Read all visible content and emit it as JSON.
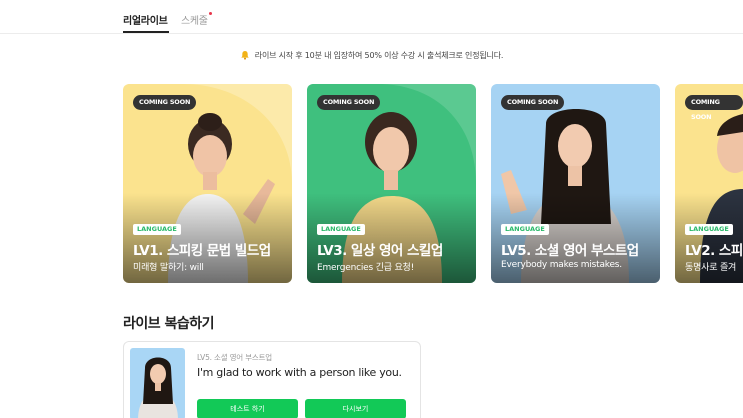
{
  "tabs": {
    "live": "리얼라이브",
    "schedule": "스케줄"
  },
  "notice": {
    "text": "라이브 시작 후 10분 내 입장하여 50% 이상 수강 시 출석체크로 인정됩니다."
  },
  "cards": [
    {
      "status": "COMING SOON",
      "category": "LANGUAGE",
      "title": "LV1. 스피킹 문법 빌드업",
      "subtitle": "미래형 말하기: will",
      "bg_color": "#fbe38e"
    },
    {
      "status": "COMING SOON",
      "category": "LANGUAGE",
      "title": "LV3. 일상 영어 스킬업",
      "subtitle": "Emergencies 긴급 요청!",
      "bg_color": "#3fc07e"
    },
    {
      "status": "COMING SOON",
      "category": "LANGUAGE",
      "title": "LV5. 소셜 영어 부스트업",
      "subtitle": "Everybody makes mistakes.",
      "bg_color": "#a6d3f3"
    },
    {
      "status": "COMING SOON",
      "category": "LANGUAGE",
      "title": "LV2. 스피",
      "subtitle": "동명사로 즐겨",
      "bg_color": "#fbe38e"
    }
  ],
  "review": {
    "heading": "라이브 복습하기",
    "course": "LV5. 소셜 영어 부스트업",
    "sentence": "I'm glad to work with a person like you.",
    "test_button": "테스트 하기",
    "retry_button": "다시보기"
  },
  "colors": {
    "accent": "#12c957",
    "new_dot": "#e8364b",
    "category_text": "#2ab96a"
  }
}
